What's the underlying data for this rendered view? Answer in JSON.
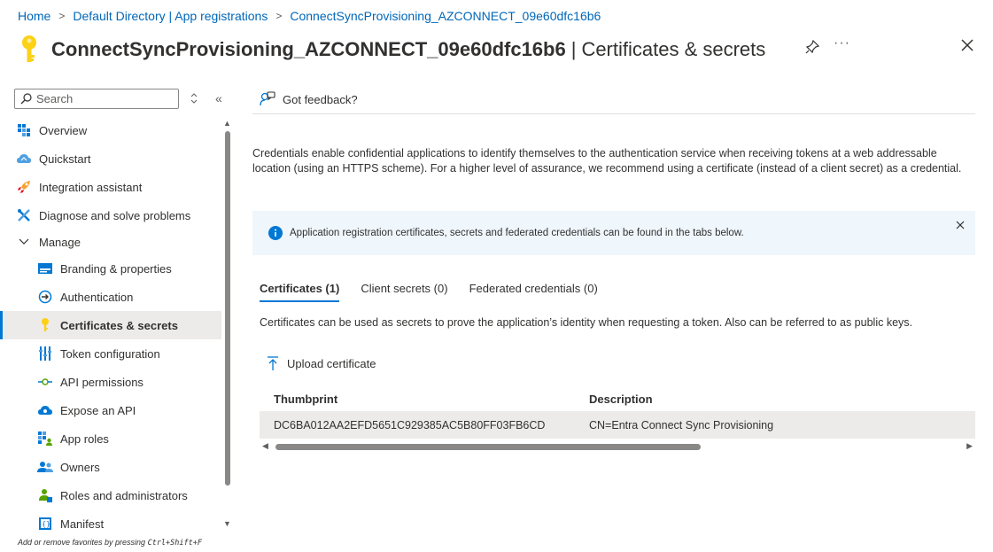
{
  "breadcrumb": {
    "items": [
      "Home",
      "Default Directory | App registrations",
      "ConnectSyncProvisioning_AZCONNECT_09e60dfc16b6"
    ],
    "separator": ">"
  },
  "header": {
    "app_name": "ConnectSyncProvisioning_AZCONNECT_09e60dfc16b6",
    "pipe": "|",
    "page": "Certificates & secrets",
    "more": "···"
  },
  "sidebar": {
    "search_placeholder": "Search",
    "collapse": "«",
    "items": [
      {
        "label": "Overview",
        "icon": "overview-icon"
      },
      {
        "label": "Quickstart",
        "icon": "quickstart-icon"
      },
      {
        "label": "Integration assistant",
        "icon": "rocket-icon"
      },
      {
        "label": "Diagnose and solve problems",
        "icon": "wrench-icon"
      },
      {
        "label": "Manage",
        "icon": "chevron-down-icon"
      },
      {
        "label": "Branding & properties",
        "icon": "branding-icon"
      },
      {
        "label": "Authentication",
        "icon": "authentication-icon"
      },
      {
        "label": "Certificates & secrets",
        "icon": "key-icon",
        "selected": true
      },
      {
        "label": "Token configuration",
        "icon": "token-icon"
      },
      {
        "label": "API permissions",
        "icon": "api-permissions-icon"
      },
      {
        "label": "Expose an API",
        "icon": "cloud-icon"
      },
      {
        "label": "App roles",
        "icon": "app-roles-icon"
      },
      {
        "label": "Owners",
        "icon": "owners-icon"
      },
      {
        "label": "Roles and administrators",
        "icon": "roles-icon"
      },
      {
        "label": "Manifest",
        "icon": "manifest-icon"
      }
    ],
    "hint_prefix": "Add or remove favorites by pressing ",
    "hint_shortcut": "Ctrl+Shift+F"
  },
  "main": {
    "feedback_label": "Got feedback?",
    "description": "Credentials enable confidential applications to identify themselves to the authentication service when receiving tokens at a web addressable location (using an HTTPS scheme). For a higher level of assurance, we recommend using a certificate (instead of a client secret) as a credential.",
    "info_banner": "Application registration certificates, secrets and federated credentials can be found in the tabs below.",
    "tabs": [
      {
        "label": "Certificates (1)",
        "active": true
      },
      {
        "label": "Client secrets (0)",
        "active": false
      },
      {
        "label": "Federated credentials (0)",
        "active": false
      }
    ],
    "tab_description": "Certificates can be used as secrets to prove the application’s identity when requesting a token. Also can be referred to as public keys.",
    "upload_label": "Upload certificate",
    "table": {
      "columns": [
        "Thumbprint",
        "Description"
      ],
      "rows": [
        [
          "DC6BA012AA2EFD5651C929385AC5B80FF03FB6CD",
          "CN=Entra Connect Sync Provisioning"
        ]
      ]
    }
  },
  "colors": {
    "accent": "#0078d4",
    "link": "#0067b8",
    "selected_bg": "#edebe9",
    "info_bg": "#eff6fc",
    "key_yellow": "#fcd116"
  }
}
